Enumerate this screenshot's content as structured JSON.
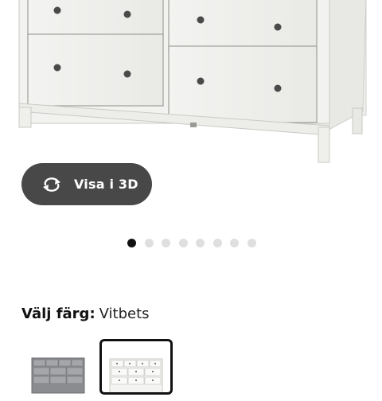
{
  "product": {
    "view_3d_label": "Visa i 3D",
    "view_3d_icon": "rotate-3d-icon"
  },
  "carousel": {
    "total": 8,
    "active_index": 0
  },
  "color_selector": {
    "label": "Välj färg:",
    "selected_value": "Vitbets",
    "swatches": [
      {
        "name": "grey",
        "selected": false
      },
      {
        "name": "white",
        "selected": true
      }
    ]
  },
  "colors": {
    "button_bg": "#484848",
    "dot_active": "#111111",
    "dot_inactive": "#dfdfdf"
  }
}
